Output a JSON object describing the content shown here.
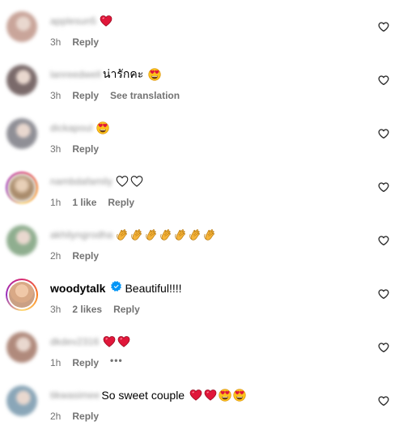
{
  "comments": [
    {
      "username": "applesun5",
      "text": "",
      "emojis": [
        "red-heart"
      ],
      "time": "3h",
      "likes": "",
      "reply": "Reply",
      "translate": "",
      "avatar": "#c9a59a",
      "verified": false
    },
    {
      "username": "lanreedwell",
      "text": "น่ารักคะ",
      "emojis": [
        "heart-eyes"
      ],
      "time": "3h",
      "likes": "",
      "reply": "Reply",
      "translate": "See translation",
      "avatar": "#7a6a6a",
      "verified": false
    },
    {
      "username": "dickapoul",
      "text": "",
      "emojis": [
        "heart-eyes"
      ],
      "time": "3h",
      "likes": "",
      "reply": "Reply",
      "translate": "",
      "avatar": "#8f8f96",
      "verified": false
    },
    {
      "username": "nambdafamily",
      "text": "",
      "emojis": [
        "white-heart",
        "white-heart"
      ],
      "time": "1h",
      "likes": "1 like",
      "reply": "Reply",
      "translate": "",
      "avatar": "#a88a6a",
      "verified": false
    },
    {
      "username": "akhilyngrodha",
      "text": "",
      "emojis": [
        "clap",
        "clap",
        "clap",
        "clap",
        "clap",
        "clap",
        "clap"
      ],
      "time": "2h",
      "likes": "",
      "reply": "Reply",
      "translate": "",
      "avatar": "#8fae8f",
      "verified": false
    },
    {
      "username": "woodytalk",
      "text": "Beautiful!!!!",
      "emojis": [],
      "time": "3h",
      "likes": "2 likes",
      "reply": "Reply",
      "translate": "",
      "avatar": "#d9a986",
      "verified": true
    },
    {
      "username": "dkdev2316",
      "text": "",
      "emojis": [
        "red-heart",
        "red-heart"
      ],
      "time": "1h",
      "likes": "",
      "reply": "Reply",
      "translate": "",
      "avatar": "#b08a7c",
      "verified": false,
      "more": "•••"
    },
    {
      "username": "tikwasimee",
      "text": "So sweet couple",
      "emojis": [
        "red-heart",
        "red-heart",
        "heart-eyes",
        "heart-eyes"
      ],
      "time": "2h",
      "likes": "",
      "reply": "Reply",
      "translate": "",
      "avatar": "#8aa6b8",
      "verified": false
    }
  ],
  "colors": {
    "meta": "#737373",
    "like_heart": "#262626",
    "verified": "#0095f6"
  }
}
